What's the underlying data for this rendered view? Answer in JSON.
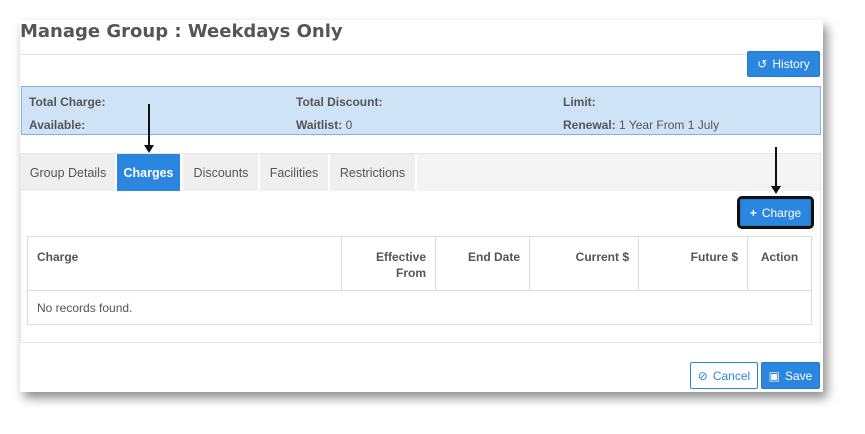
{
  "page": {
    "title": "Manage Group : Weekdays Only"
  },
  "toolbar": {
    "history_label": "History",
    "history_icon": "history-icon"
  },
  "summary": {
    "total_charge_label": "Total Charge:",
    "total_charge_value": "",
    "total_discount_label": "Total Discount:",
    "total_discount_value": "",
    "limit_label": "Limit:",
    "limit_value": "",
    "available_label": "Available:",
    "available_value": "",
    "waitlist_label": "Waitlist:",
    "waitlist_value": "0",
    "renewal_label": "Renewal:",
    "renewal_value": "1 Year From 1 July"
  },
  "tabs": [
    {
      "label": "Group Details",
      "active": false
    },
    {
      "label": "Charges",
      "active": true
    },
    {
      "label": "Discounts",
      "active": false
    },
    {
      "label": "Facilities",
      "active": false
    },
    {
      "label": "Restrictions",
      "active": false
    }
  ],
  "charges": {
    "add_label": "Charge",
    "add_icon": "plus-icon",
    "columns": [
      "Charge",
      "Effective From",
      "End Date",
      "Current $",
      "Future $",
      "Action"
    ],
    "empty_message": "No records found."
  },
  "footer": {
    "cancel_label": "Cancel",
    "cancel_icon": "ban-icon",
    "save_label": "Save",
    "save_icon": "floppy-disk-icon"
  },
  "colors": {
    "accent": "#2b86df",
    "summary_bg": "#cfe3f7",
    "summary_border": "#7fb3e6"
  }
}
